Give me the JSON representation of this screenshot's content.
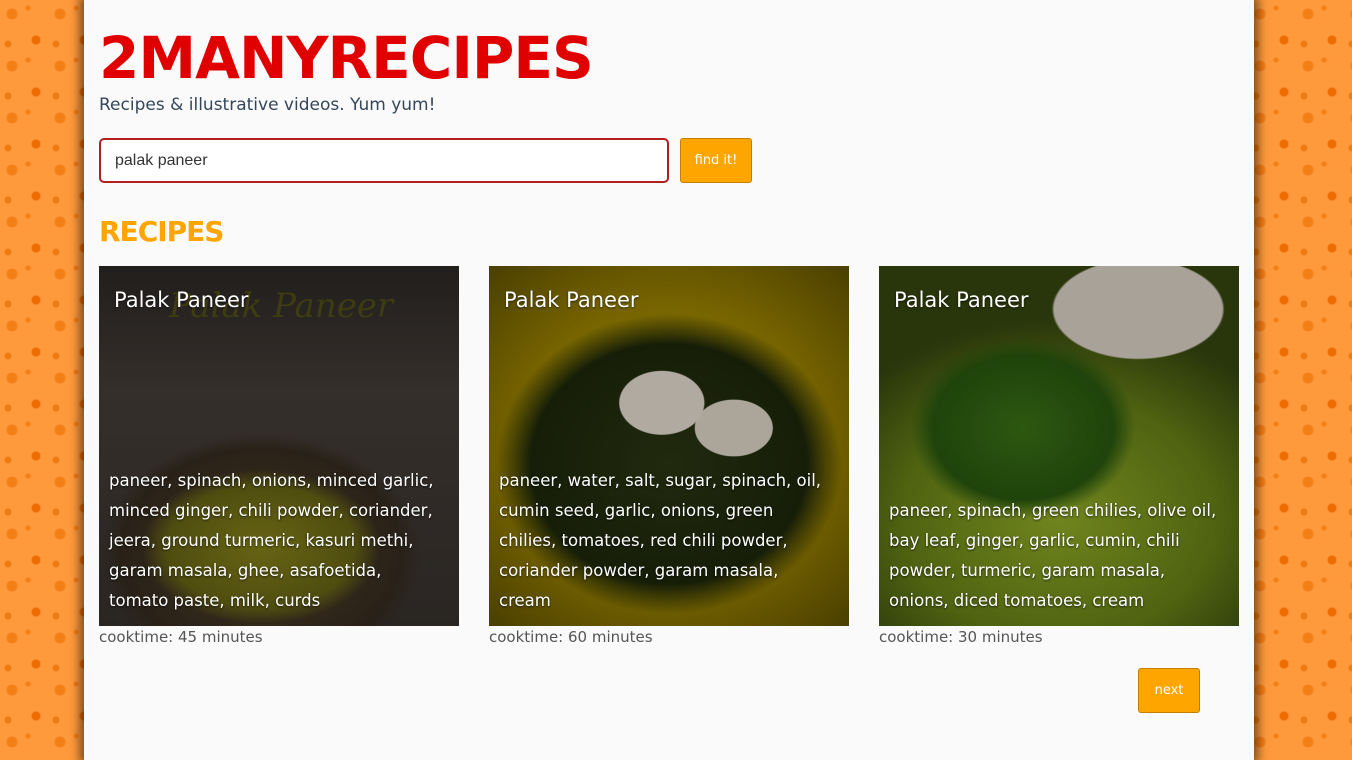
{
  "site": {
    "brand": "2MANYRECIPES",
    "tagline": "Recipes & illustrative videos. Yum yum!"
  },
  "search": {
    "value": "palak paneer",
    "button_label": "find it!"
  },
  "results": {
    "heading": "RECIPES",
    "cards": [
      {
        "title": "Palak Paneer",
        "ingredients": "paneer, spinach, onions, minced garlic, minced ginger, chili powder, coriander, jeera, ground turmeric, kasuri methi, garam masala, ghee, asafoetida, tomato paste, milk, curds",
        "cooktime": "cooktime: 45 minutes",
        "image_logo_text": "Palak Paneer"
      },
      {
        "title": "Palak Paneer",
        "ingredients": "paneer, water, salt, sugar, spinach, oil, cumin seed, garlic, onions, green chilies, tomatoes, red chili powder, coriander powder, garam masala, cream",
        "cooktime": "cooktime: 60 minutes"
      },
      {
        "title": "Palak Paneer",
        "ingredients": "paneer, spinach, green chilies, olive oil, bay leaf, ginger, garlic, cumin, chili powder, turmeric, garam masala, onions, diced tomatoes, cream",
        "cooktime": "cooktime: 30 minutes"
      }
    ]
  },
  "pagination": {
    "next_label": "next"
  },
  "colors": {
    "brand": "#e00000",
    "accent": "#ffa500",
    "background": "#ff9a3c"
  }
}
